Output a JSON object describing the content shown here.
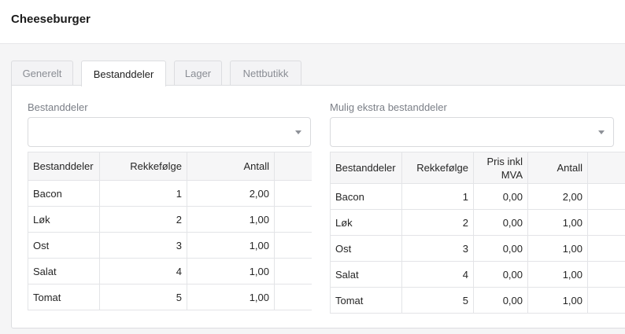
{
  "page": {
    "title": "Cheeseburger"
  },
  "tabs": [
    {
      "label": "Generelt",
      "active": false
    },
    {
      "label": "Bestanddeler",
      "active": true
    },
    {
      "label": "Lager",
      "active": false
    },
    {
      "label": "Nettbutikk",
      "active": false
    }
  ],
  "left": {
    "field_label": "Bestanddeler",
    "select_value": "",
    "columns": [
      "Bestanddeler",
      "Rekkefølge",
      "Antall"
    ],
    "rows": [
      {
        "name": "Bacon",
        "order": "1",
        "amount": "2,00"
      },
      {
        "name": "Løk",
        "order": "2",
        "amount": "1,00"
      },
      {
        "name": "Ost",
        "order": "3",
        "amount": "1,00"
      },
      {
        "name": "Salat",
        "order": "4",
        "amount": "1,00"
      },
      {
        "name": "Tomat",
        "order": "5",
        "amount": "1,00"
      }
    ]
  },
  "right": {
    "field_label": "Mulig ekstra bestanddeler",
    "select_value": "",
    "columns": [
      "Bestanddeler",
      "Rekkefølge",
      "Pris inkl MVA",
      "Antall"
    ],
    "rows": [
      {
        "name": "Bacon",
        "order": "1",
        "price": "0,00",
        "amount": "2,00"
      },
      {
        "name": "Løk",
        "order": "2",
        "price": "0,00",
        "amount": "1,00"
      },
      {
        "name": "Ost",
        "order": "3",
        "price": "0,00",
        "amount": "1,00"
      },
      {
        "name": "Salat",
        "order": "4",
        "price": "0,00",
        "amount": "1,00"
      },
      {
        "name": "Tomat",
        "order": "5",
        "price": "0,00",
        "amount": "1,00"
      }
    ]
  }
}
